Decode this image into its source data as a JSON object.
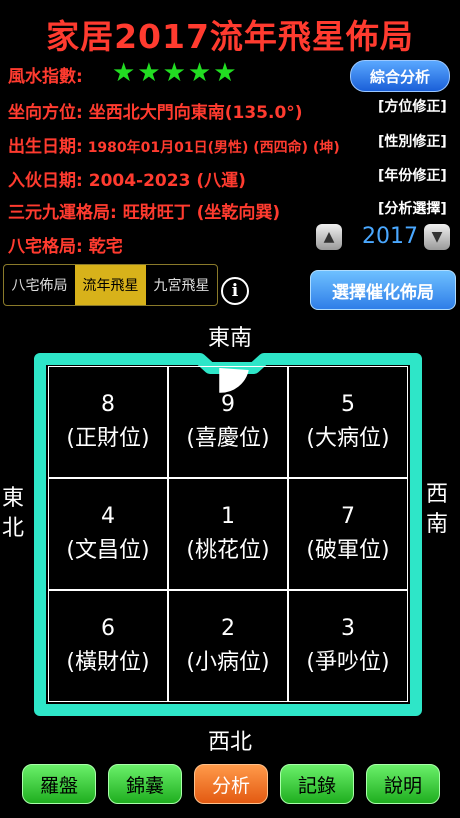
{
  "title": "家居2017流年飛星佈局",
  "fengshui": {
    "label": "風水指數:",
    "stars": "★★★★★"
  },
  "analysis_button": "綜合分析",
  "rows": [
    {
      "label": "坐向方位:",
      "value": "坐西北大門向東南(135.0°)",
      "button": "[方位修正]"
    },
    {
      "label": "出生日期:",
      "value": "1980年01月01日(男性) (西四命) (坤)",
      "button": "[性別修正]"
    },
    {
      "label": "入伙日期:",
      "value": "2004-2023 (八運)",
      "button": "[年份修正]"
    },
    {
      "label": "三元九運格局:",
      "value": "旺財旺丁 (坐乾向巽)",
      "button": "[分析選擇]"
    },
    {
      "label": "八宅格局:",
      "value": "乾宅"
    }
  ],
  "year": "2017",
  "tabs": [
    "八宅佈局",
    "流年飛星",
    "九宮飛星"
  ],
  "active_tab": "流年飛星",
  "info_icon": "i",
  "select_button": "選擇催化佈局",
  "directions": {
    "top": "東南",
    "bottom": "西北",
    "left": [
      "東",
      "北"
    ],
    "right": [
      "西",
      "南"
    ]
  },
  "cells": [
    {
      "num": "8",
      "label": "(正財位)"
    },
    {
      "num": "9",
      "label": "(喜慶位)"
    },
    {
      "num": "5",
      "label": "(大病位)"
    },
    {
      "num": "4",
      "label": "(文昌位)"
    },
    {
      "num": "1",
      "label": "(桃花位)"
    },
    {
      "num": "7",
      "label": "(破軍位)"
    },
    {
      "num": "6",
      "label": "(橫財位)"
    },
    {
      "num": "2",
      "label": "(小病位)"
    },
    {
      "num": "3",
      "label": "(爭吵位)"
    }
  ],
  "bottom_buttons": [
    "羅盤",
    "錦囊",
    "分析",
    "記錄",
    "說明"
  ],
  "colors": {
    "accent": "#ff3b2f",
    "wall": "#2ee6c8",
    "stars": "#22dd22",
    "year": "#4aa8ff"
  }
}
